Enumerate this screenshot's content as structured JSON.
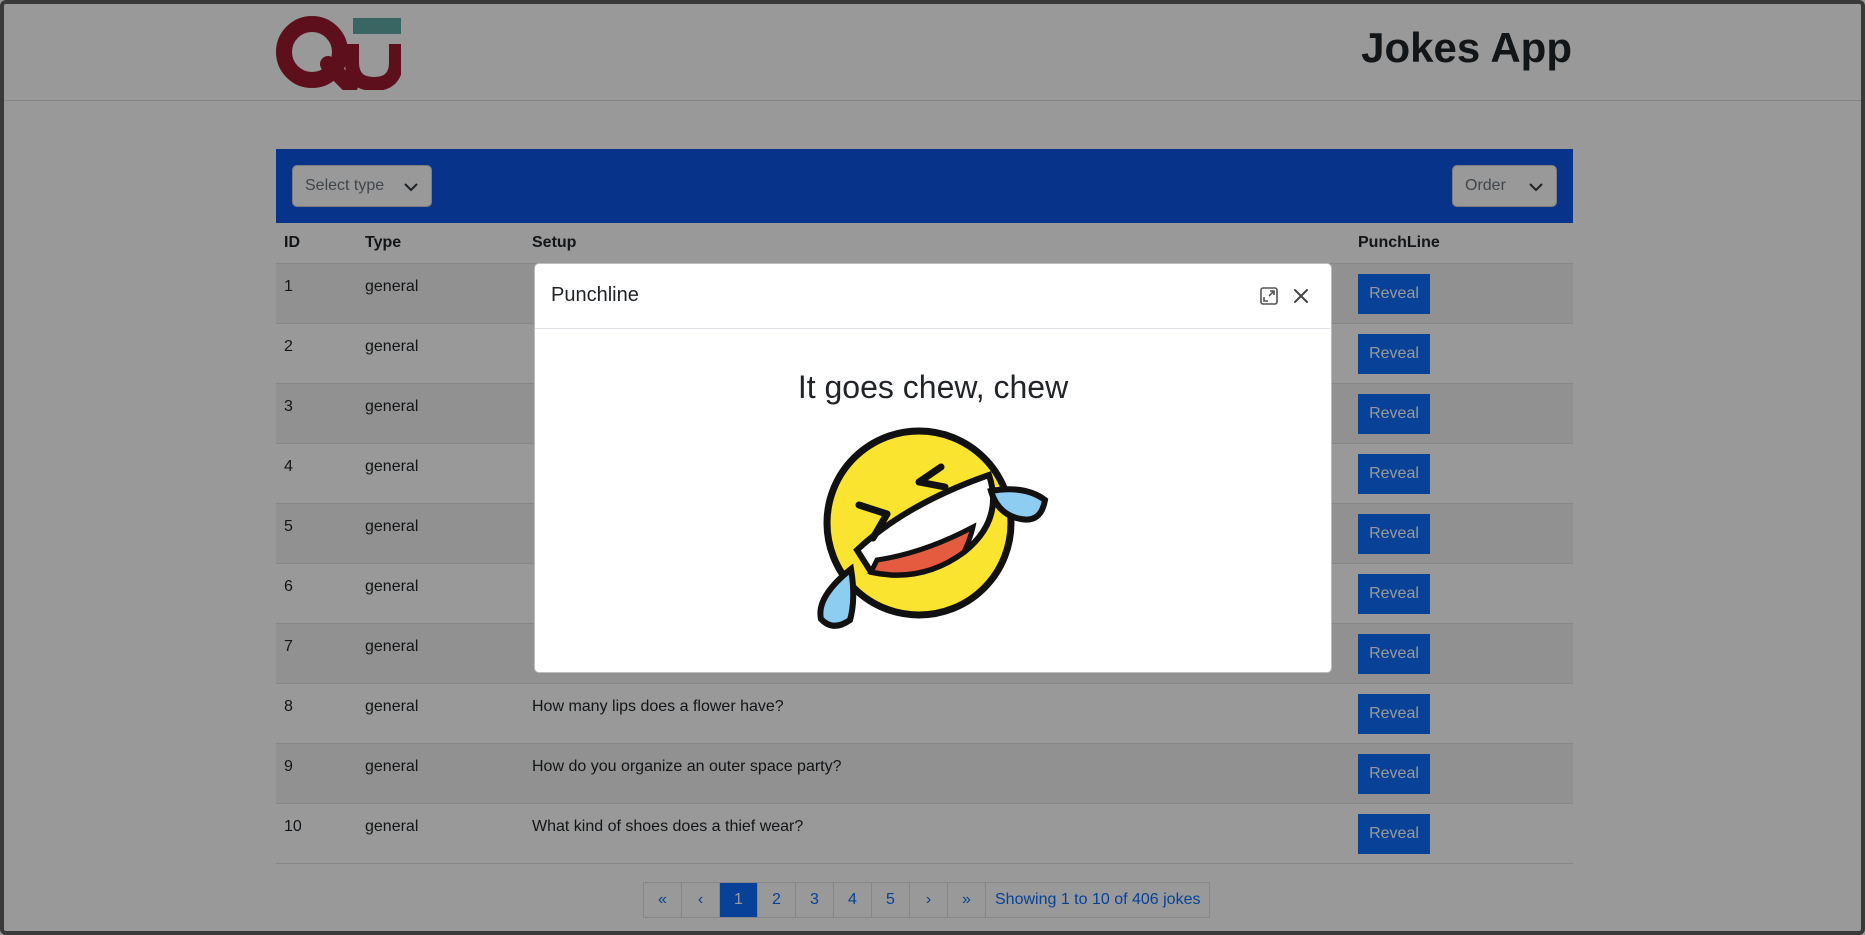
{
  "header": {
    "app_title": "Jokes App",
    "logo_icon": "qu-logo-icon"
  },
  "toolbar": {
    "type_select": "Select type",
    "order_select": "Order"
  },
  "table": {
    "columns": [
      "ID",
      "Type",
      "Setup",
      "PunchLine"
    ],
    "reveal_label": "Reveal",
    "rows": [
      {
        "id": "1",
        "type": "general",
        "setup": ""
      },
      {
        "id": "2",
        "type": "general",
        "setup": ""
      },
      {
        "id": "3",
        "type": "general",
        "setup": ""
      },
      {
        "id": "4",
        "type": "general",
        "setup": ""
      },
      {
        "id": "5",
        "type": "general",
        "setup": ""
      },
      {
        "id": "6",
        "type": "general",
        "setup": ""
      },
      {
        "id": "7",
        "type": "general",
        "setup": ""
      },
      {
        "id": "8",
        "type": "general",
        "setup": "How many lips does a flower have?"
      },
      {
        "id": "9",
        "type": "general",
        "setup": "How do you organize an outer space party?"
      },
      {
        "id": "10",
        "type": "general",
        "setup": "What kind of shoes does a thief wear?"
      }
    ]
  },
  "pagination": {
    "first": "«",
    "prev": "‹",
    "pages": [
      "1",
      "2",
      "3",
      "4",
      "5"
    ],
    "active_page": "1",
    "next": "›",
    "last": "»",
    "info": "Showing 1 to 10 of 406 jokes"
  },
  "modal": {
    "title": "Punchline",
    "punchline": "It goes chew, chew",
    "emoji_icon": "rolling-on-floor-laughing-icon"
  },
  "colors": {
    "primary": "#0d6efd",
    "toolbar": "#0d57e7",
    "logo_red": "#9b1b30",
    "logo_teal": "#5fa8a3"
  }
}
